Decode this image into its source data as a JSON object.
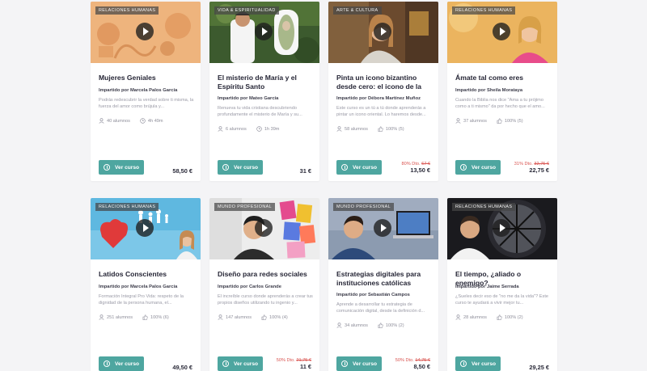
{
  "cards": [
    {
      "badge": "RELACIONES HUMANAS",
      "title": "Mujeres Geniales",
      "teacher": "Impartido por Marcela Palos García",
      "desc": "Podrás redescubrir la verdad sobre ti misma, la fuerza del amor como brújula y...",
      "meta1": "40 alumnos",
      "meta2": "4h 49m",
      "button": "Ver curso",
      "discount": "",
      "old_price": "",
      "price": "58,50 €"
    },
    {
      "badge": "VIDA & ESPIRITUALIDAD",
      "title": "El misterio de María y el Espíritu Santo",
      "teacher": "Impartido por Mateo García",
      "desc": "Renueva tu vida cristiana descubriendo profundamente el misterio de María y su...",
      "meta1": "6 alumnos",
      "meta2": "1h 39m",
      "button": "Ver curso",
      "discount": "",
      "old_price": "",
      "price": "31 €"
    },
    {
      "badge": "ARTE & CULTURA",
      "title": "Pinta un icono bizantino desde cero: el icono de la Madre de...",
      "teacher": "Impartido por Débora Martínez Muñoz",
      "desc": "Este curso es un tú a tú donde aprenderás a pintar un icono oriental. Lo haremos desde...",
      "meta1": "58 alumnos",
      "meta2": "100% (5)",
      "button": "Ver curso",
      "discount": "80% Dto.",
      "old_price": "67 €",
      "price": "13,50 €"
    },
    {
      "badge": "RELACIONES HUMANAS",
      "title": "Ámate tal como eres",
      "teacher": "Impartido por Sheila Morataya",
      "desc": "Cuando la Biblia nos dice \"Ama a tu prójimo como a ti mismo\" da por hecho que el amo...",
      "meta1": "37 alumnos",
      "meta2": "100% (5)",
      "button": "Ver curso",
      "discount": "31% Dto.",
      "old_price": "32,75 €",
      "price": "22,75 €"
    },
    {
      "badge": "RELACIONES HUMANAS",
      "title": "Latidos Conscientes",
      "teacher": "Impartido por Marcela Palos García",
      "desc": "Formación Integral Pro Vida: respeto de la dignidad de la persona humana, el...",
      "meta1": "251 alumnos",
      "meta2": "100% (6)",
      "button": "Ver curso",
      "discount": "",
      "old_price": "",
      "price": "49,50 €"
    },
    {
      "badge": "MUNDO PROFESIONAL",
      "title": "Diseño para redes sociales",
      "teacher": "Impartido por Carlos Grande",
      "desc": "El increíble curso donde aprenderás a crear tus propios diseños utilizando tu ingenio y...",
      "meta1": "147 alumnos",
      "meta2": "100% (4)",
      "button": "Ver curso",
      "discount": "50% Dto.",
      "old_price": "21,75 €",
      "price": "11 €"
    },
    {
      "badge": "MUNDO PROFESIONAL",
      "title": "Estrategias digitales para instituciones católicas",
      "teacher": "Impartido por Sebastián Campos",
      "desc": "Aprende a desarrollar tu estrategia de comunicación digital, desde la definición d...",
      "meta1": "34 alumnos",
      "meta2": "100% (2)",
      "button": "Ver curso",
      "discount": "50% Dto.",
      "old_price": "14,75 €",
      "price": "8,50 €"
    },
    {
      "badge": "RELACIONES HUMANAS",
      "title": "El tiempo, ¿aliado o enemigo?",
      "teacher": "Impartido por Jaime Serrada",
      "desc": "¿Sueles decir eso de \"no me da la vida\"? Este curso te ayudará a vivir mejor tu...",
      "meta1": "28 alumnos",
      "meta2": "100% (2)",
      "button": "Ver curso",
      "discount": "",
      "old_price": "",
      "price": "29,25 €"
    }
  ]
}
